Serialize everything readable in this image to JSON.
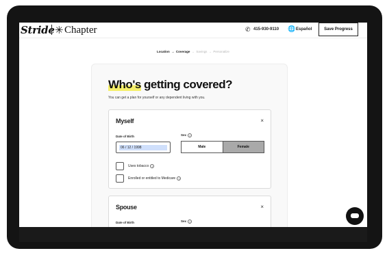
{
  "header": {
    "brand_stride": "Stride",
    "brand_chapter_icon": "✳",
    "brand_chapter": "Chapter",
    "phone": "415-930-9110",
    "language": "Español",
    "save_button": "Save Progress",
    "icons": {
      "phone": "phone-icon",
      "language": "globe-icon"
    }
  },
  "steps": [
    {
      "label": "Location",
      "state": "active"
    },
    {
      "label": "Coverage",
      "state": "active"
    },
    {
      "label": "Savings",
      "state": "inactive"
    },
    {
      "label": "Personalize",
      "state": "inactive"
    }
  ],
  "step_arrow": "→",
  "page": {
    "title_highlight": "Who's",
    "title_rest": " getting covered?",
    "subtitle": "You can get a plan for yourself or any dependent living with you.",
    "highlight_color": "#f5ef6a"
  },
  "myself": {
    "name": "Myself",
    "close": "×",
    "dob_label": "Date of Birth",
    "dob_value": "06 / 12 / 1998",
    "sex_label": "Sex",
    "sex_options": [
      "Male",
      "Female"
    ],
    "sex_selected": "Female",
    "tobacco_label": "Uses tobacco",
    "medicare_label": "Enrolled or entitled to Medicare"
  },
  "spouse": {
    "name": "Spouse",
    "close": "×",
    "dob_label": "Date of Birth",
    "sex_label": "Sex"
  },
  "help_glyph": "?"
}
